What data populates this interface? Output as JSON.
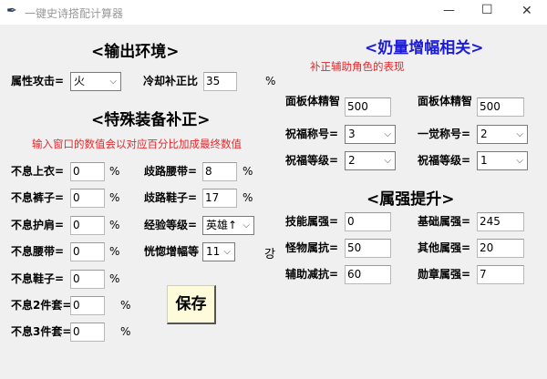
{
  "window": {
    "title": "一键史诗搭配计算器",
    "minimize": "—",
    "maximize": "☐",
    "close": "✕"
  },
  "env": {
    "title": "<输出环境>",
    "attr_label": "属性攻击=",
    "attr_value": "火",
    "cool_label": "冷却补正比",
    "cool_value": "35",
    "pct": "%"
  },
  "equip": {
    "title": "<特殊装备补正>",
    "hint": "输入窗口的数值会以对应百分比加成最终数值",
    "left": [
      {
        "label": "不息上衣=",
        "value": "0"
      },
      {
        "label": "不息裤子=",
        "value": "0"
      },
      {
        "label": "不息护肩=",
        "value": "0"
      },
      {
        "label": "不息腰带=",
        "value": "0"
      },
      {
        "label": "不息鞋子=",
        "value": "0"
      },
      {
        "label": "不息2件套=",
        "value": "0"
      },
      {
        "label": "不息3件套=",
        "value": "0"
      }
    ],
    "belt_label": "歧路腰带=",
    "belt_value": "8",
    "shoe_label": "歧路鞋子=",
    "shoe_value": "17",
    "exp_label": "经验等级=",
    "exp_value": "英雄↑",
    "amp_label": "恍惚增幅等",
    "amp_value": "11",
    "amp_unit": "강",
    "pct": "%"
  },
  "save_label": "保存",
  "buff": {
    "title": "<奶量增幅相关>",
    "hint": "补正辅助角色的表现",
    "stat1_label": "面板体精智",
    "stat1_value": "500",
    "stat2_label": "面板体精智",
    "stat2_value": "500",
    "bless_title_label": "祝福称号=",
    "bless_title_value": "3",
    "awake_title_label": "一觉称号=",
    "awake_title_value": "2",
    "bless_lv1_label": "祝福等级=",
    "bless_lv1_value": "2",
    "bless_lv2_label": "祝福等级=",
    "bless_lv2_value": "1"
  },
  "elem": {
    "title": "<属强提升>",
    "left": [
      {
        "label": "技能属强=",
        "value": "0"
      },
      {
        "label": "怪物属抗=",
        "value": "50"
      },
      {
        "label": "辅助减抗=",
        "value": "60"
      }
    ],
    "right": [
      {
        "label": "基础属强=",
        "value": "245"
      },
      {
        "label": "其他属强=",
        "value": "20"
      },
      {
        "label": "勋章属强=",
        "value": "7"
      }
    ]
  }
}
